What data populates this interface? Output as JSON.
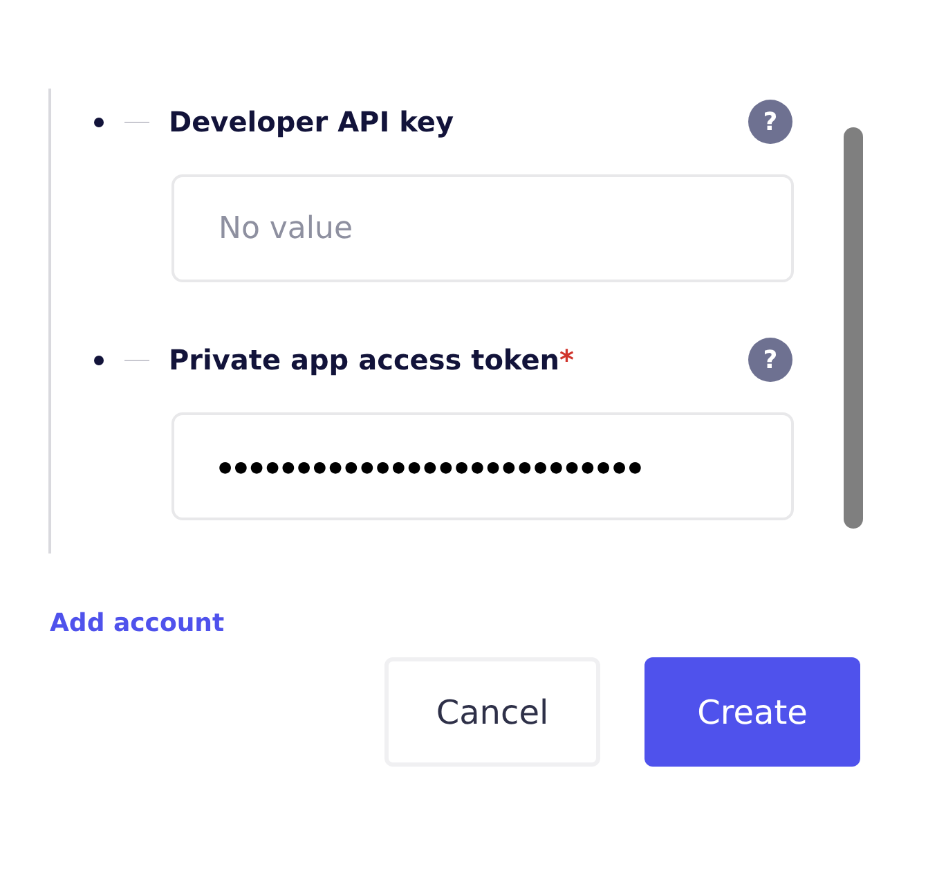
{
  "required_mark": "*",
  "fields": [
    {
      "label": "Developer API key",
      "required": false,
      "help": "?",
      "placeholder": "No value"
    },
    {
      "label": "Private app access token",
      "required": true,
      "help": "?",
      "value": "●●●●●●●●●●●●●●●●●●●●●●●●●●●"
    }
  ],
  "add_link": "Add account",
  "buttons": [
    {
      "label": "Cancel",
      "kind": "secondary"
    },
    {
      "label": "Create",
      "kind": "primary"
    }
  ]
}
